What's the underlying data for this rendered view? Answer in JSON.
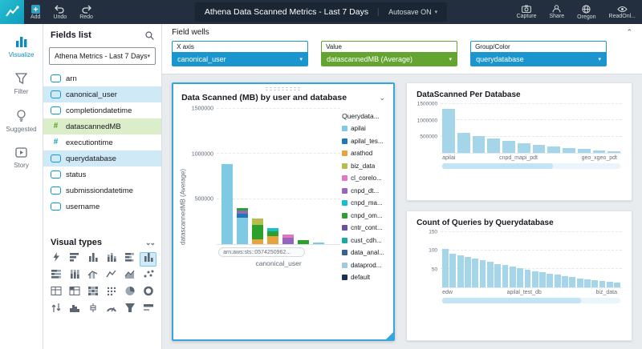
{
  "topbar": {
    "add": "Add",
    "undo": "Undo",
    "redo": "Redo",
    "title": "Athena Data Scanned Metrics - Last 7 Days",
    "autosave": "Autosave ON",
    "capture": "Capture",
    "share": "Share",
    "region": "Oregon",
    "readonly": "ReadOnl...",
    "icons": {
      "logo": "quicksight-logo",
      "add": "plus-square-icon",
      "undo": "undo-arrow-icon",
      "redo": "redo-arrow-icon",
      "capture": "camera-icon",
      "share": "person-icon",
      "region": "globe-icon",
      "readonly": "eye-icon"
    }
  },
  "nav": {
    "items": [
      {
        "id": "visualize",
        "label": "Visualize",
        "active": true
      },
      {
        "id": "filter",
        "label": "Filter",
        "active": false
      },
      {
        "id": "suggested",
        "label": "Suggested",
        "active": false
      },
      {
        "id": "story",
        "label": "Story",
        "active": false
      }
    ]
  },
  "fields_panel": {
    "title": "Fields list",
    "dataset": "Athena Metrics - Last 7 Days",
    "fields": [
      {
        "name": "arn",
        "type": "string",
        "highlight": "none"
      },
      {
        "name": "canonical_user",
        "type": "string",
        "highlight": "blue"
      },
      {
        "name": "completiondatetime",
        "type": "datetime",
        "highlight": "none"
      },
      {
        "name": "datascannedMB",
        "type": "numeric",
        "highlight": "green"
      },
      {
        "name": "executiontime",
        "type": "numeric",
        "highlight": "none"
      },
      {
        "name": "querydatabase",
        "type": "string",
        "highlight": "blue"
      },
      {
        "name": "status",
        "type": "string",
        "highlight": "none"
      },
      {
        "name": "submissiondatetime",
        "type": "datetime",
        "highlight": "none"
      },
      {
        "name": "username",
        "type": "string",
        "highlight": "none"
      }
    ]
  },
  "visual_types": {
    "title": "Visual types",
    "items": [
      {
        "kind": "auto",
        "name": "auto-graph",
        "selected": false
      },
      {
        "kind": "hbar",
        "name": "horizontal-bar",
        "selected": false
      },
      {
        "kind": "vbar",
        "name": "vertical-bar",
        "selected": false
      },
      {
        "kind": "vbarstack",
        "name": "vertical-stacked-bar",
        "selected": false
      },
      {
        "kind": "hbarstack",
        "name": "horizontal-stacked-bar",
        "selected": false
      },
      {
        "kind": "vbar",
        "name": "vertical-bar-grouped",
        "selected": true
      },
      {
        "kind": "hbar100",
        "name": "horizontal-100-stacked",
        "selected": false
      },
      {
        "kind": "vbar100",
        "name": "vertical-100-stacked",
        "selected": false
      },
      {
        "kind": "combo",
        "name": "combo-chart",
        "selected": false
      },
      {
        "kind": "line",
        "name": "line-chart",
        "selected": false
      },
      {
        "kind": "area",
        "name": "area-chart",
        "selected": false
      },
      {
        "kind": "scatter",
        "name": "scatter-plot",
        "selected": false
      },
      {
        "kind": "table",
        "name": "table",
        "selected": false
      },
      {
        "kind": "pivot",
        "name": "pivot-table",
        "selected": false
      },
      {
        "kind": "heat",
        "name": "heat-map",
        "selected": false
      },
      {
        "kind": "points",
        "name": "dot-plot",
        "selected": false
      },
      {
        "kind": "pie",
        "name": "pie-chart",
        "selected": false
      },
      {
        "kind": "donut",
        "name": "donut-chart",
        "selected": false
      },
      {
        "kind": "updown",
        "name": "sankey",
        "selected": false
      },
      {
        "kind": "hist",
        "name": "histogram",
        "selected": false
      },
      {
        "kind": "box",
        "name": "box-plot",
        "selected": false
      },
      {
        "kind": "gauge",
        "name": "gauge",
        "selected": false
      },
      {
        "kind": "funnel",
        "name": "funnel-chart",
        "selected": false
      },
      {
        "kind": "kpi",
        "name": "kpi",
        "selected": false
      }
    ]
  },
  "field_wells": {
    "title": "Field wells",
    "wells": [
      {
        "label": "X axis",
        "value": "canonical_user",
        "color": "#1a95ce"
      },
      {
        "label": "Value",
        "value": "datascannedMB (Average)",
        "color": "#64a431"
      },
      {
        "label": "Group/Color",
        "value": "querydatabase",
        "color": "#1a95ce"
      }
    ]
  },
  "chart_data": [
    {
      "type": "bar",
      "subtype": "stacked",
      "title": "Data Scanned (MB) by user and database",
      "ylabel": "datascannedMB (Average)",
      "xlabel": "canonical_user",
      "ylim": [
        0,
        1500000
      ],
      "yticks": [
        500000,
        1000000,
        1500000
      ],
      "grid": true,
      "x_first_label": "arn:aws:sts::0574250962...",
      "legend_position": "right",
      "legend_title": "Querydata...",
      "legend": [
        {
          "label": "apilai",
          "color": "#7ec9e4"
        },
        {
          "label": "apilal_tes...",
          "color": "#1f77b4"
        },
        {
          "label": "arathod",
          "color": "#e8a33d"
        },
        {
          "label": "biz_data",
          "color": "#b5bd4f"
        },
        {
          "label": "cl_corelo...",
          "color": "#e377c2"
        },
        {
          "label": "cnpd_dt...",
          "color": "#9467bd"
        },
        {
          "label": "cnpd_ma...",
          "color": "#17becf"
        },
        {
          "label": "cnpd_om...",
          "color": "#2ca02c"
        },
        {
          "label": "cntr_cont...",
          "color": "#6b4fa0"
        },
        {
          "label": "cust_cdh...",
          "color": "#1fa8a0"
        },
        {
          "label": "data_anal...",
          "color": "#39618f"
        },
        {
          "label": "dataprod...",
          "color": "#a3c9e0"
        },
        {
          "label": "default",
          "color": "#16324f"
        }
      ],
      "bars": [
        {
          "segments": [
            {
              "color": "#7ec9e4",
              "value": 880000
            }
          ]
        },
        {
          "segments": [
            {
              "color": "#7ec9e4",
              "value": 290000
            },
            {
              "color": "#1f77b4",
              "value": 45000
            },
            {
              "color": "#9467bd",
              "value": 35000
            },
            {
              "color": "#2ca02c",
              "value": 30000
            }
          ]
        },
        {
          "segments": [
            {
              "color": "#e8a33d",
              "value": 55000
            },
            {
              "color": "#2ca02c",
              "value": 160000
            },
            {
              "color": "#b5bd4f",
              "value": 70000
            }
          ]
        },
        {
          "segments": [
            {
              "color": "#e8a33d",
              "value": 85000
            },
            {
              "color": "#2ca02c",
              "value": 55000
            },
            {
              "color": "#17becf",
              "value": 35000
            }
          ]
        },
        {
          "segments": [
            {
              "color": "#9467bd",
              "value": 75000
            },
            {
              "color": "#e377c2",
              "value": 30000
            }
          ]
        },
        {
          "segments": [
            {
              "color": "#2ca02c",
              "value": 45000
            }
          ]
        },
        {
          "segments": [
            {
              "color": "#7ec9e4",
              "value": 20000
            }
          ]
        }
      ]
    },
    {
      "type": "bar",
      "title": "DataScanned Per Database",
      "ylim": [
        0,
        1500000
      ],
      "yticks": [
        500000,
        1000000,
        1500000
      ],
      "values": [
        1350000,
        620000,
        520000,
        450000,
        370000,
        300000,
        240000,
        190000,
        150000,
        115000,
        85000,
        60000
      ],
      "bar_color": "#a5d5e8",
      "x_labels": [
        "apilai",
        "cnpd_mapi_pdt",
        "geo_xgeo_pdt"
      ],
      "scrollbar_thumb_percent": 62
    },
    {
      "type": "bar",
      "title": "Count of Queries by Querydatabase",
      "ylim": [
        0,
        150
      ],
      "yticks": [
        50,
        100,
        150
      ],
      "values": [
        105,
        92,
        87,
        82,
        78,
        73,
        69,
        64,
        60,
        56,
        52,
        48,
        44,
        41,
        37,
        34,
        31,
        28,
        25,
        22,
        20,
        17,
        15,
        13
      ],
      "bar_color": "#a5d5e8",
      "x_labels": [
        "edw",
        "apilal_test_db",
        "biz_data"
      ],
      "scrollbar_thumb_percent": 78
    }
  ]
}
